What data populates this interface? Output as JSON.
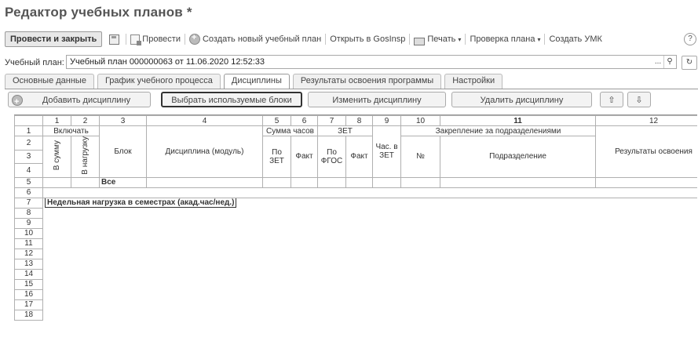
{
  "window": {
    "title": "Редактор учебных планов *",
    "help_label": "?"
  },
  "toolbar": {
    "post_close": "Провести и закрыть",
    "post": "Провести",
    "create_plan": "Создать новый учебный план",
    "open_gosinsp": "Открыть в GosInsp",
    "print": "Печать",
    "check_plan": "Проверка плана",
    "create_umk": "Создать УМК"
  },
  "plan": {
    "label": "Учебный план:",
    "value": "Учебный план 000000063 от 11.06.2020 12:52:33",
    "select_label": "..."
  },
  "tabs": [
    "Основные данные",
    "График учебного процесса",
    "Дисциплины",
    "Результаты освоения программы",
    "Настройки"
  ],
  "actions": {
    "add": "Добавить дисциплину",
    "select_blocks": "Выбрать используемые блоки",
    "edit": "Изменить дисциплину",
    "delete": "Удалить дисциплину"
  },
  "grid": {
    "col_numbers": [
      "1",
      "2",
      "3",
      "4",
      "5",
      "6",
      "7",
      "8",
      "9",
      "10",
      "11",
      "12"
    ],
    "row_numbers": [
      "1",
      "2",
      "3",
      "4",
      "5",
      "6",
      "7",
      "8",
      "9",
      "10",
      "11",
      "12",
      "13",
      "14",
      "15",
      "16",
      "17",
      "18"
    ],
    "h_include": "Включать",
    "h_in_sum": "В сумму",
    "h_in_load": "В нагрузку",
    "h_block": "Блок",
    "h_discipline": "Дисциплина (модуль)",
    "h_sum_hours": "Сумма часов",
    "h_zet": "ЗЕТ",
    "h_by_zet": "По ЗЕТ",
    "h_fact": "Факт",
    "h_by_fgos": "По ФГОС",
    "h_hours_in_zet": "Час. в ЗЕТ",
    "h_attach": "Закрепление за подразделениями",
    "h_no": "№",
    "h_division": "Подразделение",
    "h_results": "Результаты освоения",
    "row_all": "Все",
    "weekly_load": "Недельная нагрузка в семестрах (акад.час/нед.)"
  }
}
